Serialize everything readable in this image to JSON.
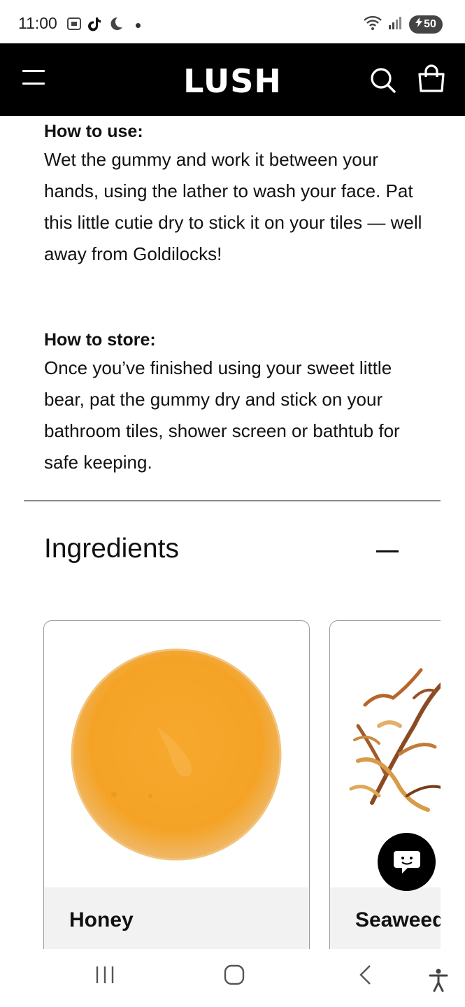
{
  "status_bar": {
    "time": "11:00",
    "battery": "50"
  },
  "header": {
    "logo": "LUSH"
  },
  "how_to_use": {
    "title": "How to use:",
    "body": "Wet the gummy and work it between your hands, using the lather to wash your face. Pat this little cutie dry to stick it on your tiles — well away from Goldilocks!"
  },
  "how_to_store": {
    "title": "How to store:",
    "body": "Once you’ve finished using your sweet little bear, pat the gummy dry and stick on your bathroom tiles, shower screen or bathtub for safe keeping."
  },
  "ingredients": {
    "title": "Ingredients",
    "items": [
      {
        "name": "Honey"
      },
      {
        "name": "Seaweed"
      }
    ]
  },
  "colors": {
    "header_bg": "#000000",
    "honey": "#F5A623",
    "card_label_bg": "#F2F2F3"
  },
  "icons": {
    "menu": "hamburger-menu-icon",
    "search": "search-icon",
    "bag": "shopping-bag-icon",
    "chat": "chat-icon"
  }
}
